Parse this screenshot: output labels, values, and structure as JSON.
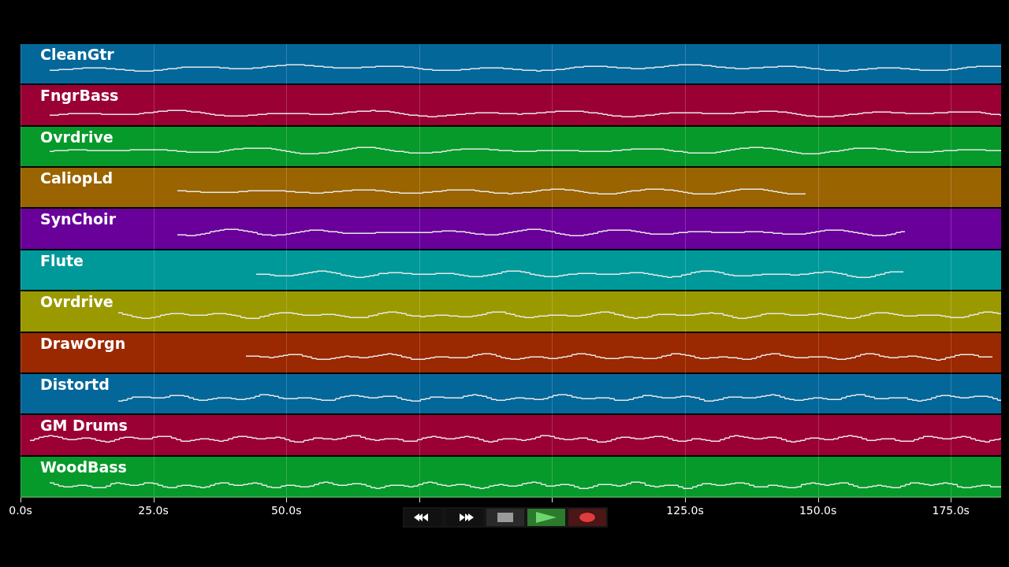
{
  "tracks": [
    {
      "name": "CleanGtr",
      "color": "#04679a"
    },
    {
      "name": "FngrBass",
      "color": "#9b0034"
    },
    {
      "name": "Ovrdrive",
      "color": "#069a2b"
    },
    {
      "name": "CaliopLd",
      "color": "#9a6400"
    },
    {
      "name": "SynChoir",
      "color": "#69009a"
    },
    {
      "name": "Flute",
      "color": "#00999a"
    },
    {
      "name": "Ovrdrive",
      "color": "#9a9a00"
    },
    {
      "name": "DrawOrgn",
      "color": "#9a2800"
    },
    {
      "name": "Distortd",
      "color": "#04679a"
    },
    {
      "name": "GM Drums",
      "color": "#9b0034"
    },
    {
      "name": "WoodBass",
      "color": "#069a2b"
    }
  ],
  "time_axis": {
    "ticks": [
      "0.0s",
      "25.0s",
      "50.0s",
      "125.0s",
      "150.0s",
      "175.0s"
    ]
  },
  "transport": [
    {
      "kind": "rewind"
    },
    {
      "kind": "fast-forward"
    },
    {
      "kind": "stop"
    },
    {
      "kind": "play"
    },
    {
      "kind": "record"
    }
  ]
}
